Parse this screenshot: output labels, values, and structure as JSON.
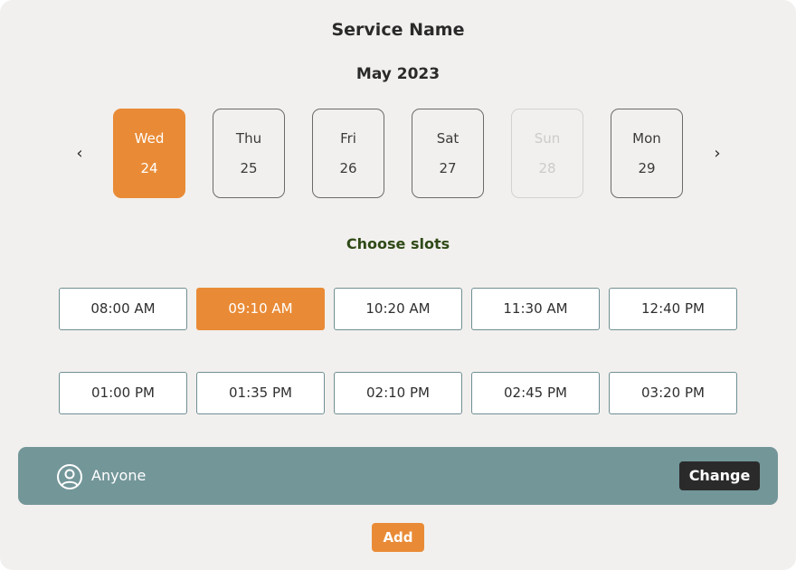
{
  "header": {
    "service_name": "Service Name",
    "month": "May 2023"
  },
  "calendar": {
    "prev_icon": "chevron-left-icon",
    "prev_glyph": "‹",
    "next_icon": "chevron-right-icon",
    "next_glyph": "›",
    "days": [
      {
        "name": "Wed",
        "date": "24",
        "state": "selected"
      },
      {
        "name": "Thu",
        "date": "25",
        "state": "default"
      },
      {
        "name": "Fri",
        "date": "26",
        "state": "default"
      },
      {
        "name": "Sat",
        "date": "27",
        "state": "default"
      },
      {
        "name": "Sun",
        "date": "28",
        "state": "disabled"
      },
      {
        "name": "Mon",
        "date": "29",
        "state": "default"
      }
    ]
  },
  "slots": {
    "title": "Choose slots",
    "times": [
      {
        "label": "08:00 AM",
        "selected": false
      },
      {
        "label": "09:10 AM",
        "selected": true
      },
      {
        "label": "10:20 AM",
        "selected": false
      },
      {
        "label": "11:30 AM",
        "selected": false
      },
      {
        "label": "12:40 PM",
        "selected": false
      },
      {
        "label": "01:00 PM",
        "selected": false
      },
      {
        "label": "01:35 PM",
        "selected": false
      },
      {
        "label": "02:10 PM",
        "selected": false
      },
      {
        "label": "02:45 PM",
        "selected": false
      },
      {
        "label": "03:20 PM",
        "selected": false
      }
    ]
  },
  "staff": {
    "icon": "user-circle-icon",
    "name": "Anyone",
    "change_label": "Change"
  },
  "actions": {
    "add_label": "Add"
  },
  "colors": {
    "accent": "#e98b36",
    "bar": "#739699",
    "slot_border": "#6f8f93",
    "slots_title": "#2f4a17",
    "background": "#f2f0ee"
  }
}
